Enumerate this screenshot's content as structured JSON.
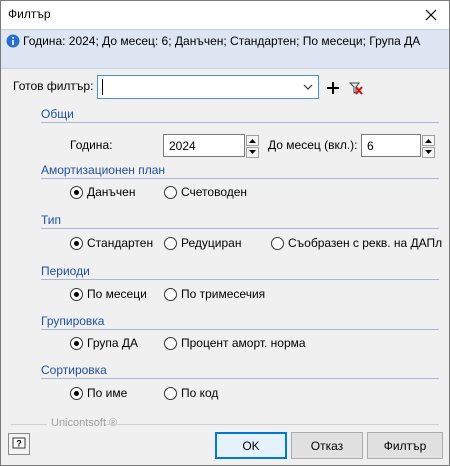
{
  "window": {
    "title": "Филтър"
  },
  "info": {
    "text": "Година: 2024; До месец: 6; Данъчен; Стандартен; По месеци; Група ДА"
  },
  "preset": {
    "label": "Готов филтър:",
    "value": ""
  },
  "sections": {
    "general": {
      "title": "Общи",
      "year_label": "Година:",
      "year_value": "2024",
      "month_label": "До месец (вкл.):",
      "month_value": "6"
    },
    "amortization": {
      "title": "Амортизационен план",
      "options": [
        {
          "label": "Данъчен",
          "selected": true
        },
        {
          "label": "Счетоводен",
          "selected": false
        }
      ]
    },
    "type": {
      "title": "Тип",
      "options": [
        {
          "label": "Стандартен",
          "selected": true
        },
        {
          "label": "Редуциран",
          "selected": false
        },
        {
          "label": "Съобразен с рекв. на ДАПл",
          "selected": false
        }
      ]
    },
    "periods": {
      "title": "Периоди",
      "options": [
        {
          "label": "По месеци",
          "selected": true
        },
        {
          "label": "По тримесечия",
          "selected": false
        }
      ]
    },
    "grouping": {
      "title": "Групировка",
      "options": [
        {
          "label": "Група ДА",
          "selected": true
        },
        {
          "label": "Процент аморт. норма",
          "selected": false
        }
      ]
    },
    "sorting": {
      "title": "Сортировка",
      "options": [
        {
          "label": "По име",
          "selected": true
        },
        {
          "label": "По код",
          "selected": false
        }
      ]
    }
  },
  "footer": {
    "brand": "Unicontsoft ®",
    "ok_label": "OK",
    "cancel_label": "Отказ",
    "filter_label": "Филтър"
  },
  "colors": {
    "accent": "#0078d7",
    "section_title": "#1f4fa3",
    "info_bg": "#dde6f2"
  }
}
